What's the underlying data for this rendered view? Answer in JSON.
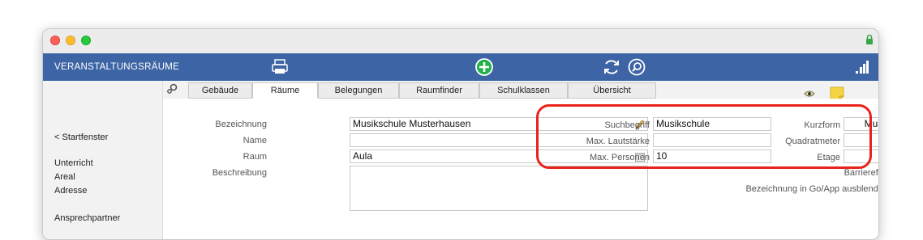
{
  "app": {
    "title": "VERANSTALTUNGSRÄUME"
  },
  "sidebar": {
    "back": "< Startfenster",
    "items": [
      "Unterricht",
      "Areal",
      "Adresse",
      "Ansprechpartner"
    ]
  },
  "tabs": [
    "Gebäude",
    "Räume",
    "Belegungen",
    "Raumfinder",
    "Schulklassen",
    "Übersicht"
  ],
  "active_tab": "Räume",
  "form": {
    "bezeichnung": {
      "label": "Bezeichnung",
      "value": "Musikschule Musterhausen"
    },
    "name": {
      "label": "Name",
      "value": ""
    },
    "raum": {
      "label": "Raum",
      "value": "Aula"
    },
    "beschreibung": {
      "label": "Beschreibung",
      "value": ""
    },
    "suchbegriff": {
      "label": "Suchbegriff",
      "value": "Musikschule"
    },
    "max_lautstaerke": {
      "label": "Max. Lautstärke",
      "value": ""
    },
    "max_personen": {
      "label": "Max. Personen",
      "value": "10"
    },
    "kurzform": {
      "label": "Kurzform",
      "value": "Mus"
    },
    "quadratmeter": {
      "label": "Quadratmeter",
      "value": ""
    },
    "etage": {
      "label": "Etage",
      "value": ""
    },
    "barrierefrei": {
      "label": "Barrierefrei",
      "checked": true
    },
    "go_app": {
      "label": "Bezeichnung in Go/App ausblenden",
      "checked": false
    }
  },
  "colors": {
    "header_blue": "#3d64a4",
    "highlight_red": "#e8231b",
    "add_green": "#22b14c"
  },
  "icons": [
    "printer-icon",
    "add-icon",
    "refresh-icon",
    "search-icon",
    "signal-icon",
    "gear-icon",
    "eye-icon",
    "note-icon",
    "pencil-icon",
    "calendar-icon",
    "lock-icon"
  ]
}
